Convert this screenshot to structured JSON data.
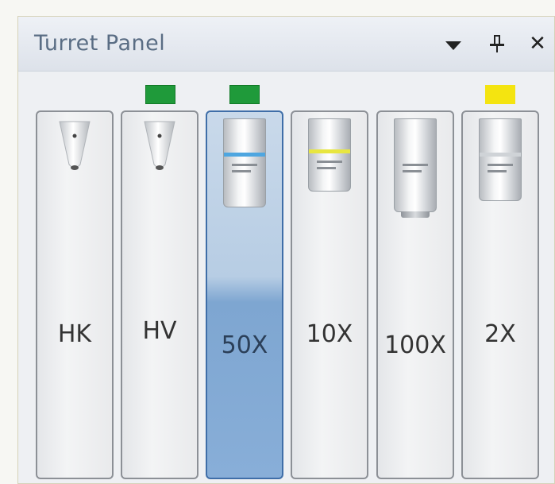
{
  "panel": {
    "title": "Turret Panel",
    "controls": {
      "dropdown_icon": "chevron-down-icon",
      "pin_icon": "pin-icon",
      "close_icon": "close-icon",
      "close_glyph": "✕"
    }
  },
  "turret": {
    "slots": [
      {
        "label": "HK",
        "image": "indenter",
        "indicator": null,
        "selected": false
      },
      {
        "label": "HV",
        "image": "indenter",
        "indicator": "green",
        "selected": false
      },
      {
        "label": "50X",
        "image": "objective",
        "indicator": "green",
        "selected": true,
        "band_color": "#4ea6e0"
      },
      {
        "label": "10X",
        "image": "objective",
        "indicator": null,
        "selected": false,
        "band_color": "#e8e640"
      },
      {
        "label": "100X",
        "image": "objective",
        "indicator": null,
        "selected": false
      },
      {
        "label": "2X",
        "image": "objective",
        "indicator": "yellow",
        "selected": false
      }
    ],
    "indicator_colors": {
      "green": "#1f9a3a",
      "yellow": "#f4e410"
    },
    "selected_color": "#7ea6d1"
  }
}
